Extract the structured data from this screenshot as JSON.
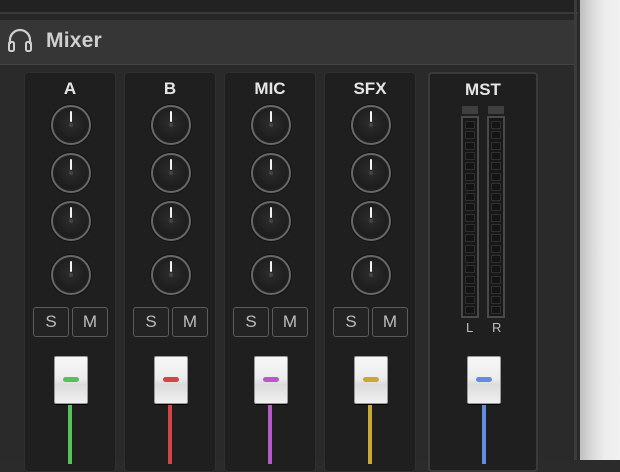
{
  "header": {
    "title": "Mixer",
    "icon": "headphones-icon"
  },
  "buttons": {
    "solo": "S",
    "mute": "M"
  },
  "channels": [
    {
      "name": "A",
      "color": "#57c05a"
    },
    {
      "name": "B",
      "color": "#d04646"
    },
    {
      "name": "MIC",
      "color": "#b25cc6"
    },
    {
      "name": "SFX",
      "color": "#c9a935"
    }
  ],
  "master": {
    "name": "MST",
    "color": "#5f8de0",
    "meter_labels": [
      "L",
      "R"
    ]
  }
}
